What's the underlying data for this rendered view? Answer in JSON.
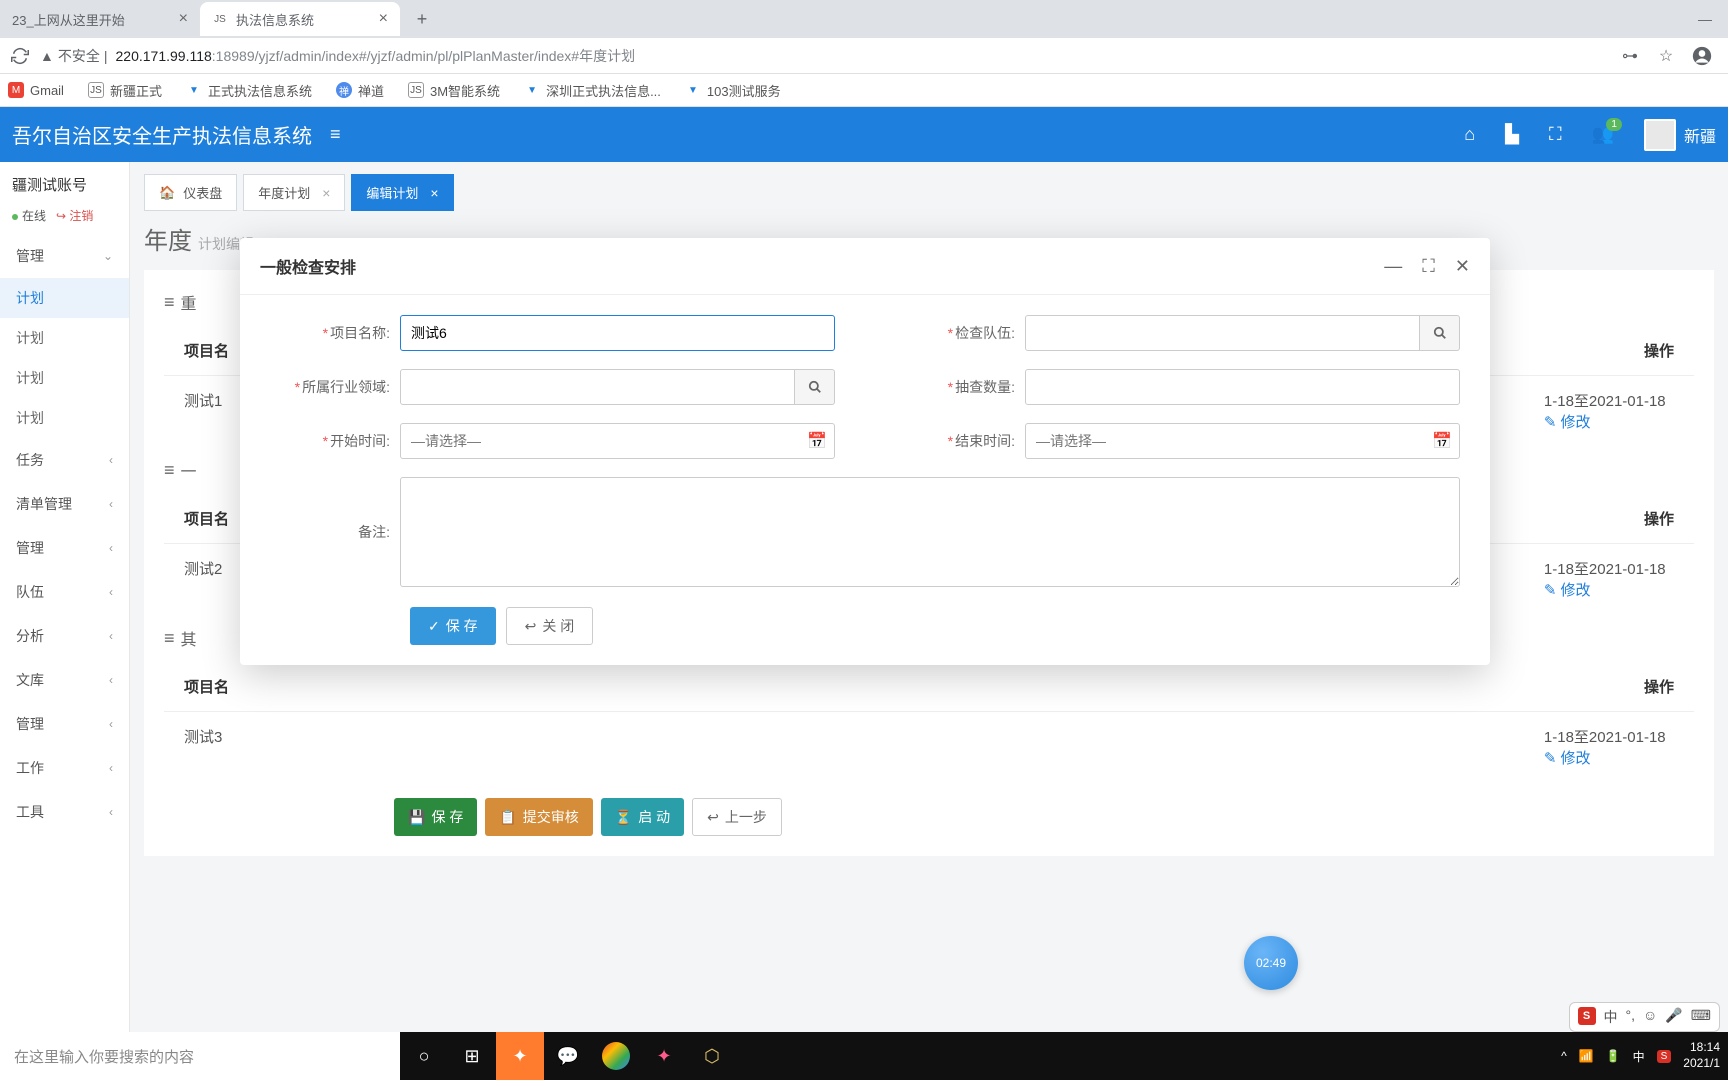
{
  "browser": {
    "tabs": [
      {
        "title": "23_上网从这里开始"
      },
      {
        "title": "执法信息系统"
      }
    ],
    "url_insecure": "不安全",
    "url_host": "220.171.99.118",
    "url_port": ":18989",
    "url_path": "/yjzf/admin/index#/yjzf/admin/pl/plPlanMaster/index#年度计划",
    "bookmarks": [
      {
        "label": "Gmail"
      },
      {
        "label": "新疆正式"
      },
      {
        "label": "正式执法信息系统"
      },
      {
        "label": "禅道"
      },
      {
        "label": "3M智能系统"
      },
      {
        "label": "深圳正式执法信息..."
      },
      {
        "label": "103测试服务"
      }
    ]
  },
  "header": {
    "title": "吾尔自治区安全生产执法信息系统",
    "notif_count": "1",
    "user": "新疆"
  },
  "sidebar": {
    "account": "疆测试账号",
    "online": "在线",
    "logout": "注销",
    "items": [
      {
        "label": "管理",
        "expanded": true
      },
      {
        "label": "计划",
        "sub": true,
        "active": true
      },
      {
        "label": "计划",
        "sub": true
      },
      {
        "label": "计划",
        "sub": true
      },
      {
        "label": "计划",
        "sub": true
      },
      {
        "label": "任务"
      },
      {
        "label": "清单管理"
      },
      {
        "label": "管理"
      },
      {
        "label": "队伍"
      },
      {
        "label": "分析"
      },
      {
        "label": "文库"
      },
      {
        "label": "管理"
      },
      {
        "label": "工作"
      },
      {
        "label": "工具"
      }
    ]
  },
  "content": {
    "tabs": [
      {
        "label": "仪表盘",
        "home": true
      },
      {
        "label": "年度计划"
      },
      {
        "label": "编辑计划",
        "active": true
      }
    ],
    "page_title": "年度",
    "page_sub": "计划编辑",
    "sections": [
      {
        "title": "重",
        "th_name": "项目名",
        "th_op": "操作",
        "row_name": "测试1",
        "row_date": "1-18至2021-01-18",
        "row_op": "修改"
      },
      {
        "title": "一",
        "th_name": "项目名",
        "th_op": "操作",
        "row_name": "测试2",
        "row_date": "1-18至2021-01-18",
        "row_op": "修改"
      },
      {
        "title": "其",
        "th_name": "项目名",
        "th_op": "操作",
        "row_name": "测试3",
        "row_date": "1-18至2021-01-18",
        "row_op": "修改"
      }
    ],
    "action_buttons": {
      "save": "保 存",
      "submit": "提交审核",
      "start": "启 动",
      "prev": "上一步"
    }
  },
  "modal": {
    "title": "一般检查安排",
    "fields": {
      "project_name": {
        "label": "项目名称:",
        "value": "测试6"
      },
      "team": {
        "label": "检查队伍:"
      },
      "industry": {
        "label": "所属行业领域:"
      },
      "sample": {
        "label": "抽查数量:"
      },
      "start": {
        "label": "开始时间:",
        "placeholder": "—请选择—"
      },
      "end": {
        "label": "结束时间:",
        "placeholder": "—请选择—"
      },
      "remark": {
        "label": "备注:"
      }
    },
    "save": "保 存",
    "close": "关 闭"
  },
  "timer": "02:49",
  "ime": {
    "mode": "中"
  },
  "taskbar": {
    "search_placeholder": "在这里输入你要搜索的内容",
    "time": "18:14",
    "date": "2021/1"
  }
}
